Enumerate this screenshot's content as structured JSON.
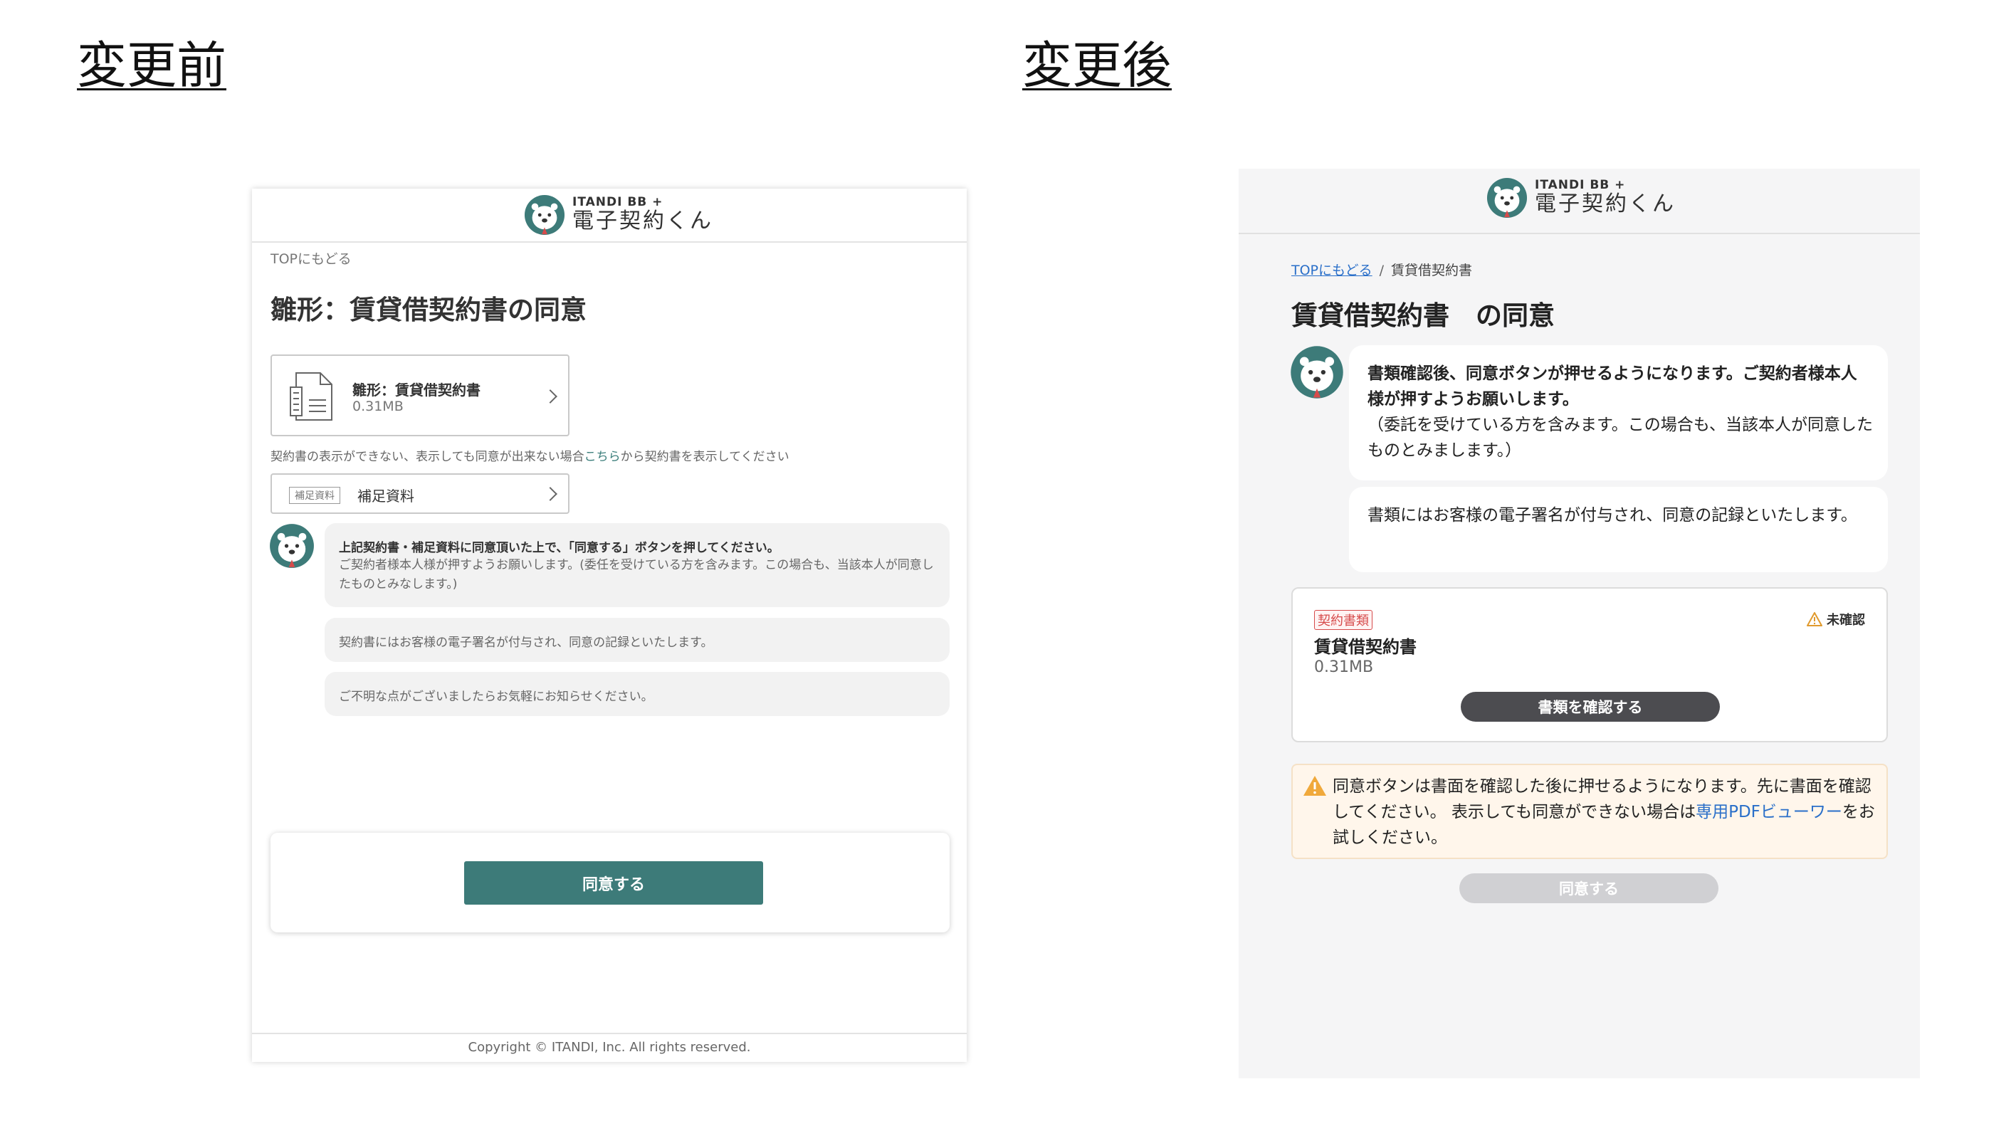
{
  "headings": {
    "before": "変更前",
    "after": "変更後"
  },
  "logo": {
    "small": "ITANDI BB +",
    "big": "電子契約くん"
  },
  "before": {
    "back_link": "TOPにもどる",
    "title": "雛形：賃貸借契約書の同意",
    "document": {
      "name": "雛形：賃貸借契約書",
      "size": "0.31MB"
    },
    "note_prefix": "契約書の表示ができない、表示しても同意が出来ない場合",
    "note_link": "こちら",
    "note_suffix": "から契約書を表示してください",
    "supplement": {
      "tag": "補足資料",
      "label": "補足資料"
    },
    "messages": {
      "m1_bold": "上記契約書・補足資料に同意頂いた上で、「同意する」ボタンを押してください。",
      "m1_text": "ご契約者様本人様が押すようお願いします。(委任を受けている方を含みます。この場合も、当該本人が同意したものとみなします。)",
      "m2": "契約書にはお客様の電子署名が付与され、同意の記録といたします。",
      "m3": "ご不明な点がございましたらお気軽にお知らせください。"
    },
    "agree_button": "同意する",
    "footer": "Copyright © ITANDI, Inc. All rights reserved."
  },
  "after": {
    "breadcrumb": {
      "top": "TOPにもどる",
      "sep": "/",
      "current": "賃貸借契約書"
    },
    "title": "賃貸借契約書　の同意",
    "messages": {
      "m1_bold": "書類確認後、同意ボタンが押せるようになります。ご契約者様本人様が押すようお願いします。",
      "m1_text": "（委託を受けている方を含みます。この場合も、当該本人が同意したものとみまします。）",
      "m2": "書類にはお客様の電子署名が付与され、同意の記録といたします。"
    },
    "document": {
      "tag": "契約書類",
      "status": "未確認",
      "name": "賃貸借契約書",
      "size": "0.31MB",
      "confirm_button": "書類を確認する"
    },
    "warning": {
      "text": "同意ボタンは書面を確認した後に押せるようになります。先に書面を確認してください。 表示しても同意ができない場合は",
      "link": "専用PDFビューワー",
      "suffix": "をお試しください。"
    },
    "agree_button": "同意する"
  },
  "colors": {
    "teal": "#3d7b79",
    "link_blue": "#2a6fc9",
    "warning_bg": "#fff6eb",
    "tag_red": "#d64b4b"
  }
}
